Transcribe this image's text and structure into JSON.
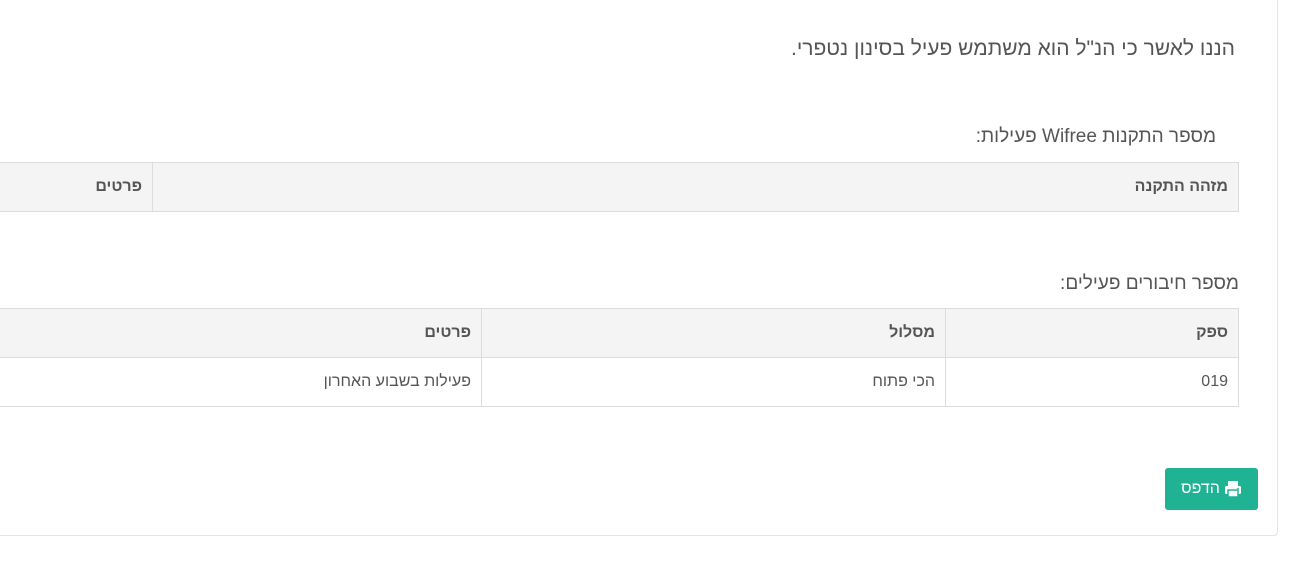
{
  "intro_text": "הננו לאשר כי הנ\"ל הוא משתמש פעיל בסינון נטפרי.",
  "installations": {
    "title": "מספר התקנות Wifree פעילות:",
    "headers": [
      "מזהה התקנה",
      "פרטים"
    ]
  },
  "connections": {
    "title": "מספר חיבורים פעילים:",
    "headers": [
      "ספק",
      "מסלול",
      "פרטים"
    ],
    "rows": [
      [
        "019",
        "הכי פתוח",
        "פעילות בשבוע האחרון"
      ]
    ]
  },
  "print_button": {
    "label": "הדפס",
    "icon": "print-icon",
    "color": "#1fb394"
  }
}
